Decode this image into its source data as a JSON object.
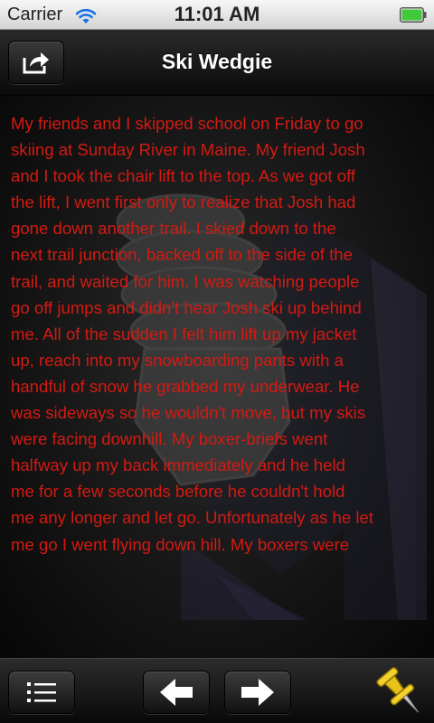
{
  "status_bar": {
    "carrier": "Carrier",
    "time": "11:01 AM",
    "wifi_icon": "wifi-icon",
    "battery_icon": "battery-full-icon",
    "battery_color": "#3fc93b"
  },
  "nav_bar": {
    "title": "Ski Wedgie",
    "share_icon": "share-arrow-icon"
  },
  "story": {
    "text": "My friends and I skipped school on Friday to go\nskiing at Sunday River in Maine.  My friend Josh\nand I took the chair lift to the top.  As we got off\nthe lift, I went first only to realize that Josh had\ngone down another trail.  I skied down to the\nnext trail junction, backed off to the side of the\ntrail, and waited for him.  I was watching people\ngo off jumps and didn't hear Josh ski up behind\nme.  All of the sudden I felt him lift up my jacket\nup, reach into my snowboarding pants with a\nhandful of snow he grabbed my underwear. He\nwas sideways so he wouldn't move, but my skis\nwere facing downhill. My boxer-briefs went\nhalfway up my back immediately and he held\nme for a few seconds before he couldn't hold\nme any longer and let go. Unfortunately as he let\nme go I went flying down hill.  My boxers were",
    "text_color": "#d41a12"
  },
  "toolbar": {
    "menu_icon": "list-icon",
    "back_icon": "arrow-left-icon",
    "forward_icon": "arrow-right-icon",
    "pin_icon": "pushpin-icon",
    "pin_color": "#e8c21a"
  }
}
